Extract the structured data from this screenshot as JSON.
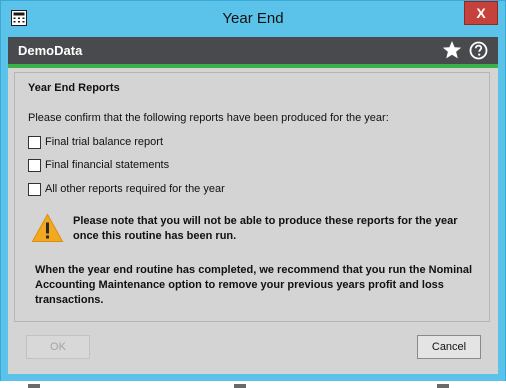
{
  "window": {
    "title": "Year End",
    "close_glyph": "X",
    "icon": "calculator-window-icon"
  },
  "header": {
    "company": "DemoData",
    "icons": [
      "star-icon",
      "help-icon"
    ],
    "accent_color": "#3bb14a",
    "bar_color": "#484a4d"
  },
  "content": {
    "section_title": "Year End Reports",
    "instruction": "Please confirm that the following reports have been produced for the year:",
    "checklist": [
      {
        "label": "Final trial balance report",
        "checked": false
      },
      {
        "label": "Final financial statements",
        "checked": false
      },
      {
        "label": "All other reports required for the year",
        "checked": false
      }
    ],
    "warning": "Please note that you will not be able to produce these reports for the year once this routine has been run.",
    "recommendation": "When the year end routine has completed, we recommend that you run the Nominal Accounting Maintenance option to remove your previous years profit and loss transactions."
  },
  "footer": {
    "ok_label": "OK",
    "ok_enabled": false,
    "cancel_label": "Cancel"
  }
}
